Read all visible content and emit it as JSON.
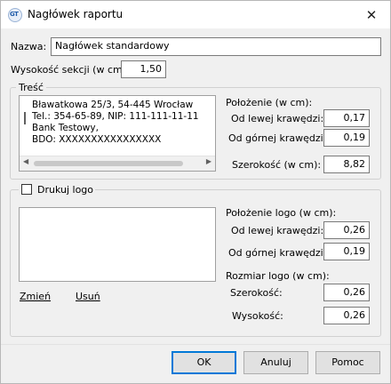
{
  "window": {
    "title": "Nagłówek raportu",
    "app_icon": "gt-app-icon",
    "close_icon": "close-icon"
  },
  "name": {
    "label": "Nazwa:",
    "value": "Nagłówek standardowy"
  },
  "section_height": {
    "label": "Wysokość sekcji (w cm):",
    "value": "1,50"
  },
  "content": {
    "legend": "Treść",
    "lines": [
      "Bławatkowa 25/3, 54-445 Wrocław",
      "Tel.: 354-65-89, NIP: 111-111-11-11",
      "Bank Testowy,",
      "BDO: XXXXXXXXXXXXXXXX"
    ],
    "position_label": "Położenie (w cm):",
    "left_label": "Od lewej krawędzi:",
    "left_value": "0,17",
    "top_label": "Od górnej krawędzi:",
    "top_value": "0,19",
    "width_label": "Szerokość (w cm):",
    "width_value": "8,82"
  },
  "logo": {
    "checkbox_label": "Drukuj logo",
    "checked": false,
    "change_link": "Zmień",
    "remove_link": "Usuń",
    "position_label": "Położenie logo (w cm):",
    "left_label": "Od lewej krawędzi:",
    "left_value": "0,26",
    "top_label": "Od górnej krawędzi:",
    "top_value": "0,19",
    "size_label": "Rozmiar logo (w cm):",
    "width_label": "Szerokość:",
    "width_value": "0,26",
    "height_label": "Wysokość:",
    "height_value": "0,26"
  },
  "buttons": {
    "ok": "OK",
    "cancel": "Anuluj",
    "help": "Pomoc"
  },
  "colors": {
    "accent": "#0078d7",
    "window_bg": "#f0f0f0"
  }
}
